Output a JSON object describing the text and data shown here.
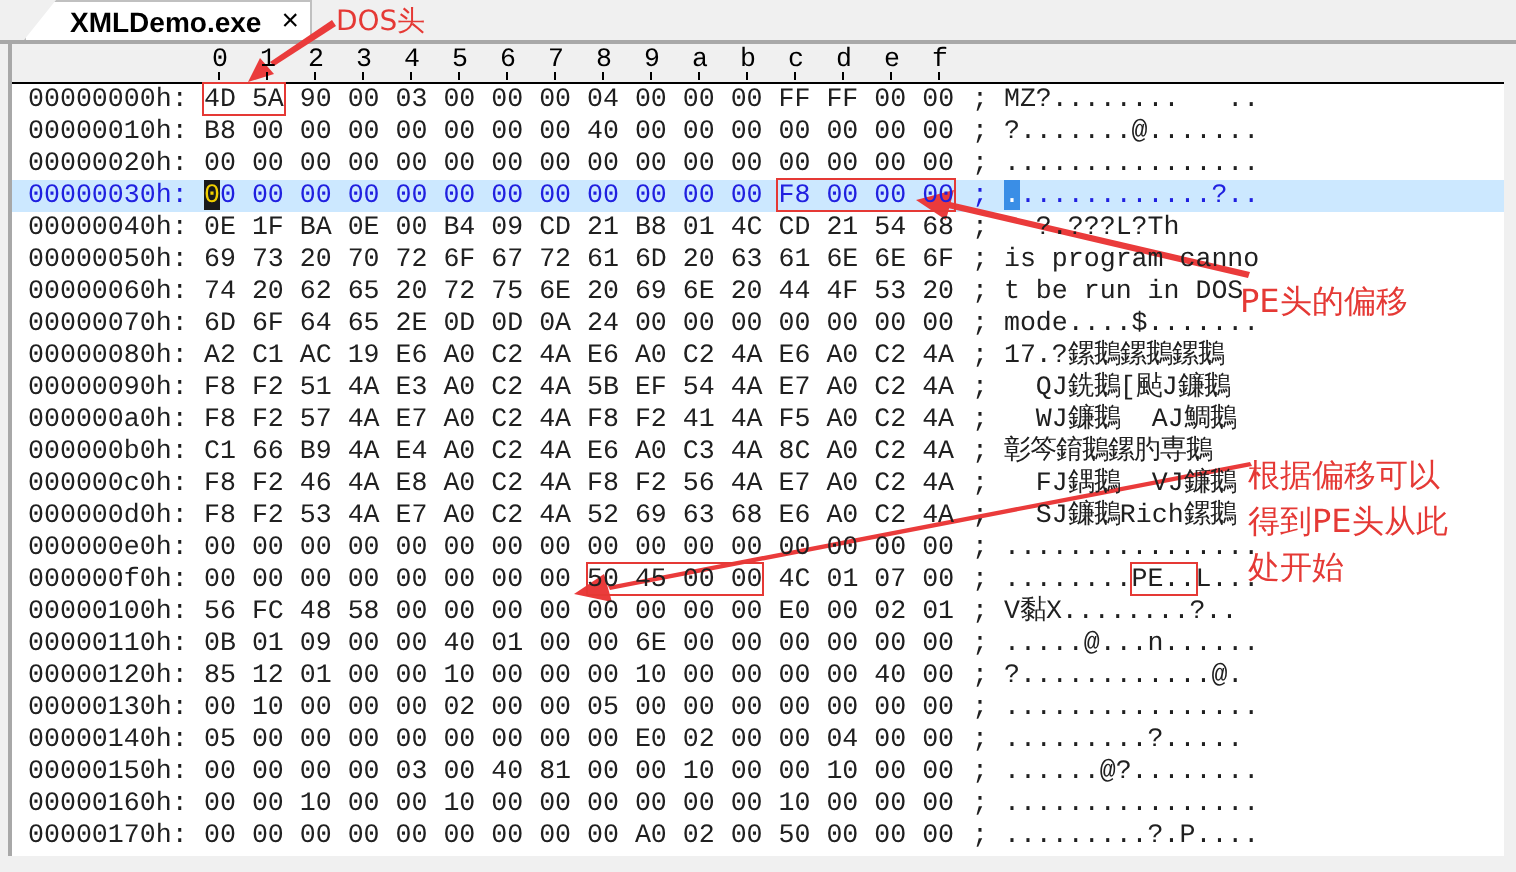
{
  "tab": {
    "title": "XMLDemo.exe",
    "close": "×",
    "selected": true
  },
  "columns": [
    "0",
    "1",
    "2",
    "3",
    "4",
    "5",
    "6",
    "7",
    "8",
    "9",
    "a",
    "b",
    "c",
    "d",
    "e",
    "f"
  ],
  "rows": [
    {
      "address": "00000000h:",
      "selected": false,
      "hex": [
        {
          "text": "4D 5A",
          "kind": "boxed"
        },
        {
          "text": " 90 00 03 00 00 00 04 00 00 00 FF FF 00 00",
          "kind": "plain"
        }
      ],
      "ascii": [
        {
          "text": "; MZ?........   ..",
          "kind": "plain"
        }
      ]
    },
    {
      "address": "00000010h:",
      "selected": false,
      "hex": [
        {
          "text": "B8 00 00 00 00 00 00 00 40 00 00 00 00 00 00 00",
          "kind": "plain"
        }
      ],
      "ascii": [
        {
          "text": "; ?.......@.......",
          "kind": "plain"
        }
      ]
    },
    {
      "address": "00000020h:",
      "selected": false,
      "hex": [
        {
          "text": "00 00 00 00 00 00 00 00 00 00 00 00 00 00 00 00",
          "kind": "plain"
        }
      ],
      "ascii": [
        {
          "text": "; ................",
          "kind": "plain"
        }
      ]
    },
    {
      "address": "00000030h:",
      "selected": true,
      "hex": [
        {
          "text": "0",
          "kind": "cursor"
        },
        {
          "text": "0 00 00 00 00 00 00 00 00 00 00 00 ",
          "kind": "plain"
        },
        {
          "text": "F8 00 00 00",
          "kind": "boxed"
        }
      ],
      "ascii": [
        {
          "text": "; ",
          "kind": "plain"
        },
        {
          "text": ".",
          "kind": "caret"
        },
        {
          "text": "............?..",
          "kind": "plain"
        }
      ]
    },
    {
      "address": "00000040h:",
      "selected": false,
      "hex": [
        {
          "text": "0E 1F BA 0E 00 B4 09 CD 21 B8 01 4C CD 21 54 68",
          "kind": "plain"
        }
      ],
      "ascii": [
        {
          "text": ";   ?.???L?Th",
          "kind": "plain"
        }
      ]
    },
    {
      "address": "00000050h:",
      "selected": false,
      "hex": [
        {
          "text": "69 73 20 70 72 6F 67 72 61 6D 20 63 61 6E 6E 6F",
          "kind": "plain"
        }
      ],
      "ascii": [
        {
          "text": "; is program canno",
          "kind": "plain"
        }
      ]
    },
    {
      "address": "00000060h:",
      "selected": false,
      "hex": [
        {
          "text": "74 20 62 65 20 72 75 6E 20 69 6E 20 44 4F 53 20",
          "kind": "plain"
        }
      ],
      "ascii": [
        {
          "text": "; t be run in DOS",
          "kind": "plain"
        }
      ]
    },
    {
      "address": "00000070h:",
      "selected": false,
      "hex": [
        {
          "text": "6D 6F 64 65 2E 0D 0D 0A 24 00 00 00 00 00 00 00",
          "kind": "plain"
        }
      ],
      "ascii": [
        {
          "text": "; mode....$.......",
          "kind": "plain"
        }
      ]
    },
    {
      "address": "00000080h:",
      "selected": false,
      "hex": [
        {
          "text": "A2 C1 AC 19 E6 A0 C2 4A E6 A0 C2 4A E6 A0 C2 4A",
          "kind": "plain"
        }
      ],
      "ascii": [
        {
          "text": "; 17.?鏍鵝鏍鵝鏍鵝",
          "kind": "plain"
        }
      ]
    },
    {
      "address": "00000090h:",
      "selected": false,
      "hex": [
        {
          "text": "F8 F2 51 4A E3 A0 C2 4A 5B EF 54 4A E7 A0 C2 4A",
          "kind": "plain"
        }
      ],
      "ascii": [
        {
          "text": ";   QJ銑鵝[颭J鐮鵝",
          "kind": "plain"
        }
      ]
    },
    {
      "address": "000000a0h:",
      "selected": false,
      "hex": [
        {
          "text": "F8 F2 57 4A E7 A0 C2 4A F8 F2 41 4A F5 A0 C2 4A",
          "kind": "plain"
        }
      ],
      "ascii": [
        {
          "text": ";   WJ鐮鵝  AJ鯛鵝",
          "kind": "plain"
        }
      ]
    },
    {
      "address": "000000b0h:",
      "selected": false,
      "hex": [
        {
          "text": "C1 66 B9 4A E4 A0 C2 4A E6 A0 C3 4A 8C A0 C2 4A",
          "kind": "plain"
        }
      ],
      "ascii": [
        {
          "text": "; 彰笒錥鵝鏍肑専鵝",
          "kind": "plain"
        }
      ]
    },
    {
      "address": "000000c0h:",
      "selected": false,
      "hex": [
        {
          "text": "F8 F2 46 4A E8 A0 C2 4A F8 F2 56 4A E7 A0 C2 4A",
          "kind": "plain"
        }
      ],
      "ascii": [
        {
          "text": ";   FJ鍝鵝  VJ鐮鵝",
          "kind": "plain"
        }
      ]
    },
    {
      "address": "000000d0h:",
      "selected": false,
      "hex": [
        {
          "text": "F8 F2 53 4A E7 A0 C2 4A 52 69 63 68 E6 A0 C2 4A",
          "kind": "plain"
        }
      ],
      "ascii": [
        {
          "text": ";   SJ鐮鵝Rich鏍鵝",
          "kind": "plain"
        }
      ]
    },
    {
      "address": "000000e0h:",
      "selected": false,
      "hex": [
        {
          "text": "00 00 00 00 00 00 00 00 00 00 00 00 00 00 00 00",
          "kind": "plain"
        }
      ],
      "ascii": [
        {
          "text": "; ................",
          "kind": "plain"
        }
      ]
    },
    {
      "address": "000000f0h:",
      "selected": false,
      "hex": [
        {
          "text": "00 00 00 00 00 00 00 00 ",
          "kind": "plain"
        },
        {
          "text": "50 45 00 00",
          "kind": "boxed"
        },
        {
          "text": " 4C 01 07 00",
          "kind": "plain"
        }
      ],
      "ascii": [
        {
          "text": "; ........",
          "kind": "plain"
        },
        {
          "text": "PE..",
          "kind": "boxed"
        },
        {
          "text": "L...",
          "kind": "plain"
        }
      ]
    },
    {
      "address": "00000100h:",
      "selected": false,
      "hex": [
        {
          "text": "56 FC 48 58 00 00 00 00 00 00 00 00 E0 00 02 01",
          "kind": "plain"
        }
      ],
      "ascii": [
        {
          "text": "; V黏X........?..",
          "kind": "plain"
        }
      ]
    },
    {
      "address": "00000110h:",
      "selected": false,
      "hex": [
        {
          "text": "0B 01 09 00 00 40 01 00 00 6E 00 00 00 00 00 00",
          "kind": "plain"
        }
      ],
      "ascii": [
        {
          "text": "; .....@...n......",
          "kind": "plain"
        }
      ]
    },
    {
      "address": "00000120h:",
      "selected": false,
      "hex": [
        {
          "text": "85 12 01 00 00 10 00 00 00 10 00 00 00 00 40 00",
          "kind": "plain"
        }
      ],
      "ascii": [
        {
          "text": "; ?............@.",
          "kind": "plain"
        }
      ]
    },
    {
      "address": "00000130h:",
      "selected": false,
      "hex": [
        {
          "text": "00 10 00 00 00 02 00 00 05 00 00 00 00 00 00 00",
          "kind": "plain"
        }
      ],
      "ascii": [
        {
          "text": "; ................",
          "kind": "plain"
        }
      ]
    },
    {
      "address": "00000140h:",
      "selected": false,
      "hex": [
        {
          "text": "05 00 00 00 00 00 00 00 00 E0 02 00 00 04 00 00",
          "kind": "plain"
        }
      ],
      "ascii": [
        {
          "text": "; .........?.....",
          "kind": "plain"
        }
      ]
    },
    {
      "address": "00000150h:",
      "selected": false,
      "hex": [
        {
          "text": "00 00 00 00 03 00 40 81 00 00 10 00 00 10 00 00",
          "kind": "plain"
        }
      ],
      "ascii": [
        {
          "text": "; ......@?........",
          "kind": "plain"
        }
      ]
    },
    {
      "address": "00000160h:",
      "selected": false,
      "hex": [
        {
          "text": "00 00 10 00 00 10 00 00 00 00 00 00 10 00 00 00",
          "kind": "plain"
        }
      ],
      "ascii": [
        {
          "text": "; ................",
          "kind": "plain"
        }
      ]
    },
    {
      "address": "00000170h:",
      "selected": false,
      "hex": [
        {
          "text": "00 00 00 00 00 00 00 00 00 A0 02 00 50 00 00 00",
          "kind": "plain"
        }
      ],
      "ascii": [
        {
          "text": "; .........?.P....",
          "kind": "plain"
        }
      ]
    }
  ],
  "annotations": [
    {
      "text": "DOS头",
      "kind": "small"
    },
    {
      "text": "PE头的偏移",
      "kind": "large"
    },
    {
      "text": "根据偏移可以得到PE头从此处开始",
      "kind": "large"
    }
  ]
}
